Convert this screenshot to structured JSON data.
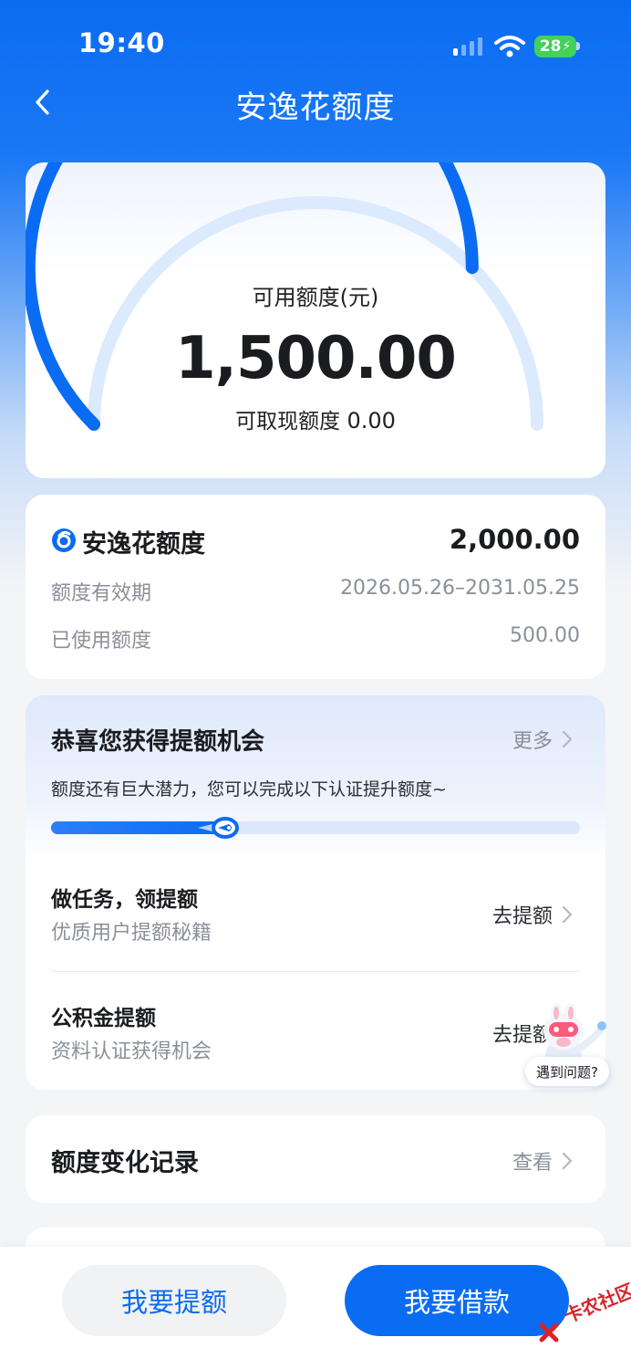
{
  "status_bar": {
    "time": "19:40",
    "battery": "28"
  },
  "nav": {
    "title": "安逸花额度"
  },
  "gauge": {
    "label": "可用额度(元)",
    "available": "1,500.00",
    "cash_label": "可取现额度",
    "cash_value": "0.00",
    "fill_fraction": 0.75,
    "accent_color": "#0a6cf2",
    "track_color": "#dbeafc"
  },
  "quota": {
    "title": "安逸花额度",
    "total": "2,000.00",
    "validity_label": "额度有效期",
    "validity_value": "2026.05.26–2031.05.25",
    "used_label": "已使用额度",
    "used_value": "500.00"
  },
  "boost": {
    "title": "恭喜您获得提额机会",
    "more": "更多",
    "subtitle": "额度还有巨大潜力，您可以完成以下认证提升额度~",
    "progress_fraction": 0.34,
    "tasks": [
      {
        "title": "做任务，领提额",
        "desc": "优质用户提额秘籍",
        "action": "去提额"
      },
      {
        "title": "公积金提额",
        "desc": "资料认证获得机会",
        "action": "去提额"
      }
    ]
  },
  "help": {
    "label": "遇到问题?"
  },
  "records": {
    "title": "额度变化记录",
    "link": "查看"
  },
  "bottom": {
    "raise_button": "我要提额",
    "borrow_button": "我要借款"
  },
  "watermark": {
    "text": "卡农社区"
  }
}
